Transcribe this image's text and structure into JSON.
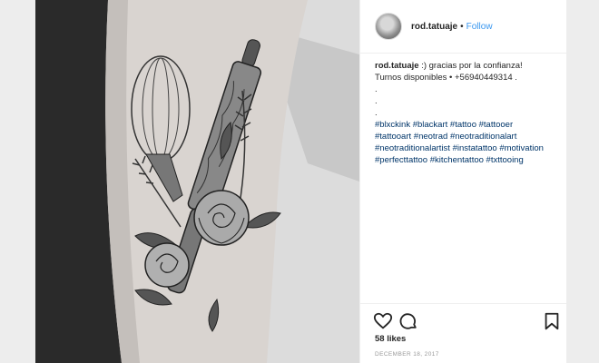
{
  "post": {
    "image_alt_icon": "tattoo-photo",
    "header": {
      "username": "rod.tatuaje",
      "separator": "•",
      "follow_label": "Follow"
    },
    "caption": {
      "username": "rod.tatuaje",
      "text": ":) gracias por la confianza!",
      "line2": "Turnos disponibles • +56940449314 .",
      "dots": [
        ".",
        ".",
        "."
      ],
      "hashtags": [
        "#blxckink",
        "#blackart",
        "#tattoo",
        "#tattooer",
        "#tattooart",
        "#neotrad",
        "#neotraditionalart",
        "#neotraditionalartist",
        "#instatattoo",
        "#motivation",
        "#perfecttattoo",
        "#kitchentattoo",
        "#txttooing"
      ]
    },
    "actions": {
      "like_icon": "heart-icon",
      "comment_icon": "comment-icon",
      "save_icon": "bookmark-icon"
    },
    "likes": "58 likes",
    "date": "DECEMBER 18, 2017"
  }
}
